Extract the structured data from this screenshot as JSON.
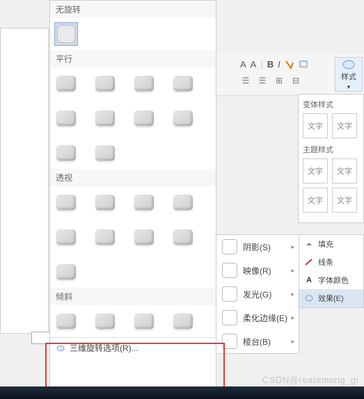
{
  "toolbar": {
    "font_controls": [
      "A",
      "A",
      "B",
      "I"
    ],
    "style_label": "样式"
  },
  "style_panel": {
    "variant_title": "变体样式",
    "theme_title": "主题样式",
    "cell_label": "文字"
  },
  "fx_menu": {
    "fill": "填充",
    "line": "线条",
    "font_color": "字体颜色",
    "effects": "效果(E)"
  },
  "effects_menu": {
    "shadow": "阴影(S)",
    "reflection": "映像(R)",
    "glow": "发光(G)",
    "soft_edges": "柔化边缘(E)",
    "bevel": "棱台(B)"
  },
  "rotation_panel": {
    "none": "无旋转",
    "parallel": "平行",
    "perspective": "透视",
    "oblique": "倾斜",
    "options": "三维旋转选项(R)..."
  },
  "watermark": "CSDN@reatamong_gi"
}
